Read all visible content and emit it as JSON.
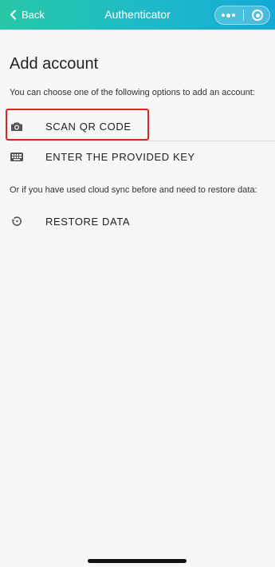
{
  "header": {
    "back_label": "Back",
    "title": "Authenticator",
    "back_icon": "chevron-left-icon",
    "more_icon": "more-dots-icon",
    "close_icon": "record-circle-icon"
  },
  "main": {
    "title": "Add account",
    "intro": "You can choose one of the following options to add an account:",
    "options": [
      {
        "label": "SCAN QR CODE",
        "icon": "camera-icon"
      },
      {
        "label": "ENTER THE PROVIDED KEY",
        "icon": "keyboard-icon"
      }
    ],
    "restore_note": "Or if you have used cloud sync before and need to restore data:",
    "restore": {
      "label": "RESTORE DATA",
      "icon": "restore-icon"
    }
  },
  "colors": {
    "header_gradient_start": "#28c8a6",
    "header_gradient_end": "#14a9d6",
    "highlight_border": "#e02424",
    "background": "#f7f7f7"
  }
}
